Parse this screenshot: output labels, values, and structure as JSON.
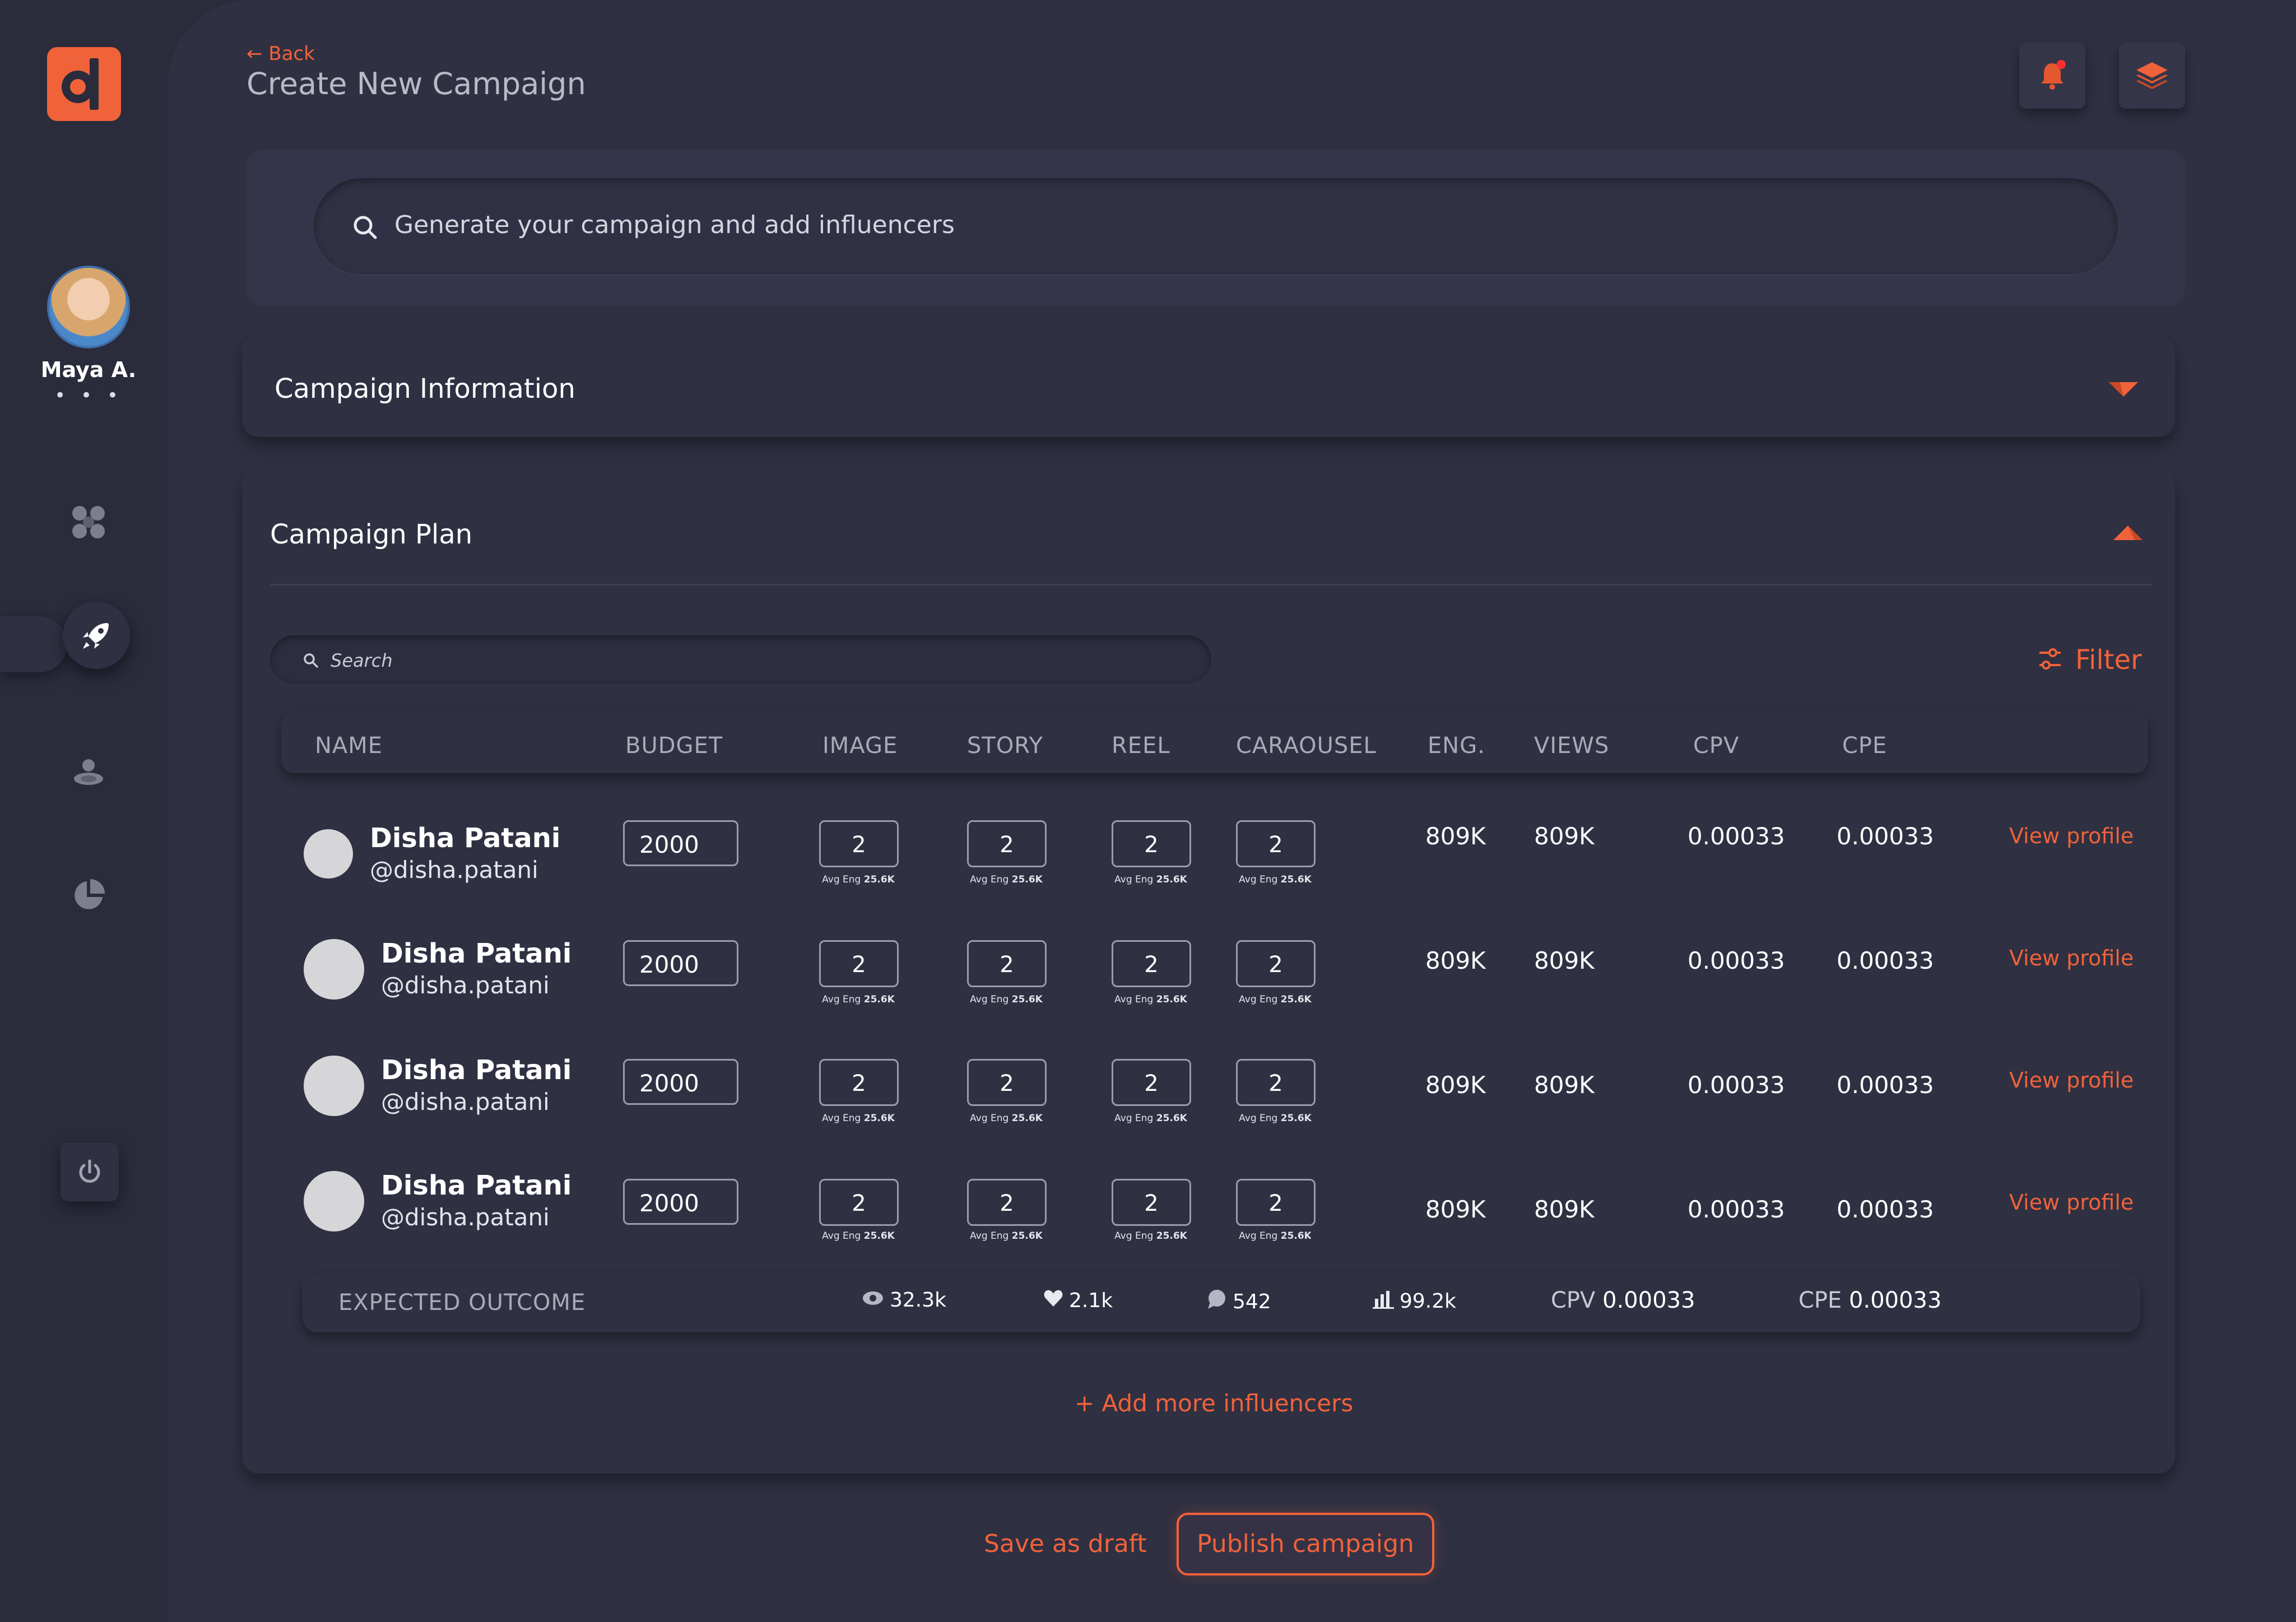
{
  "colors": {
    "accent": "#f0623a",
    "background": "#2a2b3b",
    "panel": "#2f3042"
  },
  "sidebar": {
    "logo_icon": "d-logo-icon",
    "user": {
      "name": "Maya A.",
      "menu": "• • •"
    },
    "nav": [
      {
        "icon": "dashboard-grid-icon",
        "active": false
      },
      {
        "icon": "rocket-icon",
        "active": true
      },
      {
        "icon": "users-icon",
        "active": false
      },
      {
        "icon": "pie-chart-icon",
        "active": false
      }
    ],
    "power_icon": "power-icon"
  },
  "header": {
    "back": "← Back",
    "title": "Create New Campaign",
    "notification_icon": "bell-icon",
    "layers_icon": "layers-icon"
  },
  "search": {
    "placeholder": "Generate your campaign and add influencers"
  },
  "campaign_info": {
    "title": "Campaign Information",
    "collapsed": true
  },
  "campaign_plan": {
    "title": "Campaign Plan",
    "search_placeholder": "Search",
    "filter_label": "Filter",
    "columns": [
      "NAME",
      "BUDGET",
      "IMAGE",
      "STORY",
      "REEL",
      "CARAOUSEL",
      "ENG.",
      "VIEWS",
      "CPV",
      "CPE"
    ],
    "rows": [
      {
        "name": "Disha Patani",
        "handle": "@disha.patani",
        "budget": "2000",
        "image": "2",
        "story": "2",
        "reel": "2",
        "carousel": "2",
        "avg_eng_label": "Avg Eng",
        "avg_eng_value": "25.6K",
        "eng": "809K",
        "views": "809K",
        "cpv": "0.00033",
        "cpe": "0.00033",
        "link": "View profile"
      },
      {
        "name": "Disha Patani",
        "handle": "@disha.patani",
        "budget": "2000",
        "image": "2",
        "story": "2",
        "reel": "2",
        "carousel": "2",
        "avg_eng_label": "Avg Eng",
        "avg_eng_value": "25.6K",
        "eng": "809K",
        "views": "809K",
        "cpv": "0.00033",
        "cpe": "0.00033",
        "link": "View profile"
      },
      {
        "name": "Disha Patani",
        "handle": "@disha.patani",
        "budget": "2000",
        "image": "2",
        "story": "2",
        "reel": "2",
        "carousel": "2",
        "avg_eng_label": "Avg Eng",
        "avg_eng_value": "25.6K",
        "eng": "809K",
        "views": "809K",
        "cpv": "0.00033",
        "cpe": "0.00033",
        "link": "View profile"
      },
      {
        "name": "Disha Patani",
        "handle": "@disha.patani",
        "budget": "2000",
        "image": "2",
        "story": "2",
        "reel": "2",
        "carousel": "2",
        "avg_eng_label": "Avg Eng",
        "avg_eng_value": "25.6K",
        "eng": "809K",
        "views": "809K",
        "cpv": "0.00033",
        "cpe": "0.00033",
        "link": "View profile"
      }
    ],
    "outcome": {
      "label": "EXPECTED OUTCOME",
      "views": "32.3k",
      "likes": "2.1k",
      "comments": "542",
      "reach": "99.2k",
      "cpv_label": "CPV",
      "cpv": "0.00033",
      "cpe_label": "CPE",
      "cpe": "0.00033"
    },
    "add_more": "+ Add more influencers"
  },
  "actions": {
    "save_draft": "Save as draft",
    "publish": "Publish campaign"
  }
}
